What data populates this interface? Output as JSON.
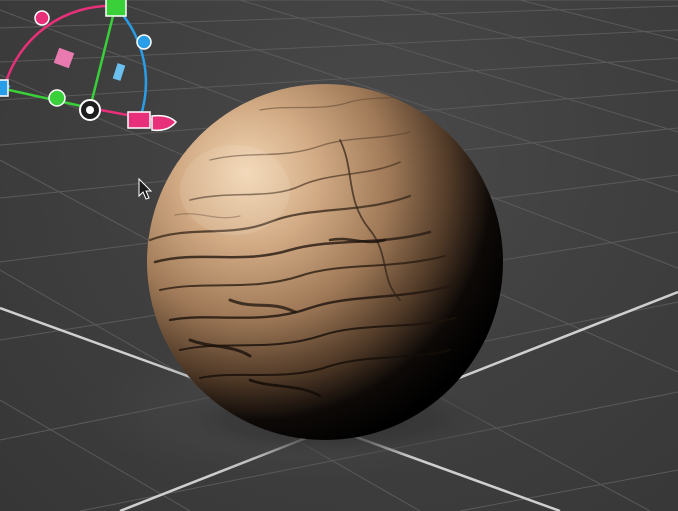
{
  "viewport": {
    "background_color": "#404040",
    "grid_color": "#5a5a5a",
    "axis_line_color": "#c8c8c8"
  },
  "object": {
    "kind": "sphere",
    "material": "rock",
    "base_color": "#b08a66",
    "highlight_color": "#f2d6b4",
    "shadow_color": "#000000"
  },
  "gizmo": {
    "type": "rotate-translate",
    "colors": {
      "x_axis": "#e8307a",
      "y_axis": "#39d039",
      "z_axis": "#2a9de8",
      "pivot": "#ffffff"
    }
  },
  "cursor": {
    "icon": "arrow-pointer-icon"
  }
}
